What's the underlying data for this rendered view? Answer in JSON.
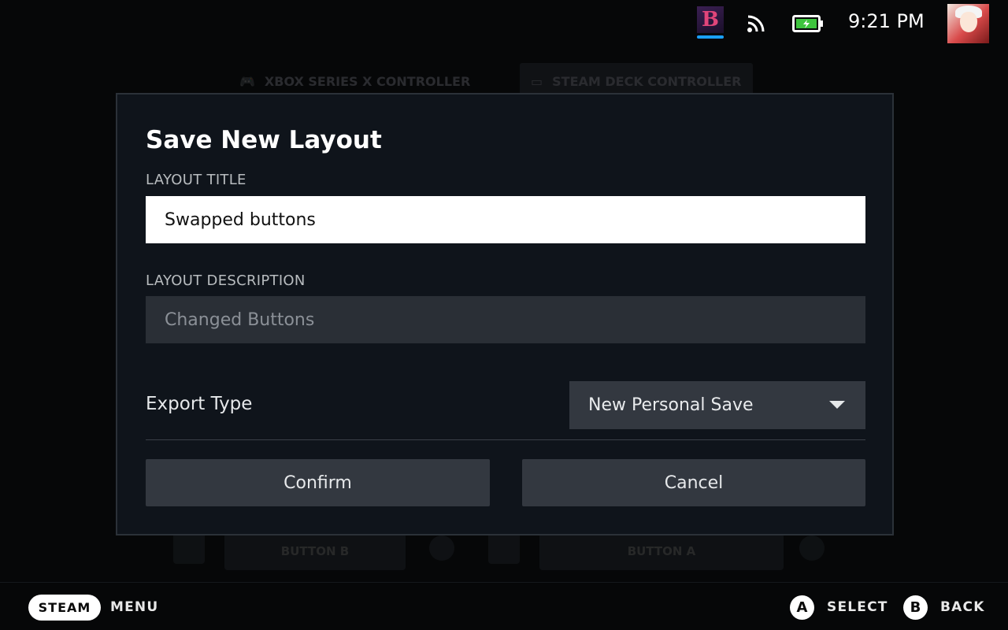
{
  "status_bar": {
    "game_icon_glyph": "B",
    "time": "9:21 PM",
    "icons": [
      "game-icon",
      "wifi-icon",
      "battery-icon",
      "avatar"
    ],
    "battery_color": "#3ec43e",
    "selection_color": "#1a9fff"
  },
  "background": {
    "tabs": [
      "XBOX SERIES X CONTROLLER",
      "STEAM DECK CONTROLLER"
    ],
    "bottom_buttons": [
      "BUTTON B",
      "BUTTON A"
    ]
  },
  "dialog": {
    "title": "Save New Layout",
    "layout_title_label": "LAYOUT TITLE",
    "layout_title_value": "Swapped buttons",
    "layout_description_label": "LAYOUT DESCRIPTION",
    "layout_description_placeholder": "Changed Buttons",
    "export_type_label": "Export Type",
    "export_type_selected": "New Personal Save",
    "confirm_label": "Confirm",
    "cancel_label": "Cancel"
  },
  "hints": {
    "steam_label": "STEAM",
    "menu_label": "MENU",
    "a_glyph": "A",
    "select_label": "SELECT",
    "b_glyph": "B",
    "back_label": "BACK"
  }
}
